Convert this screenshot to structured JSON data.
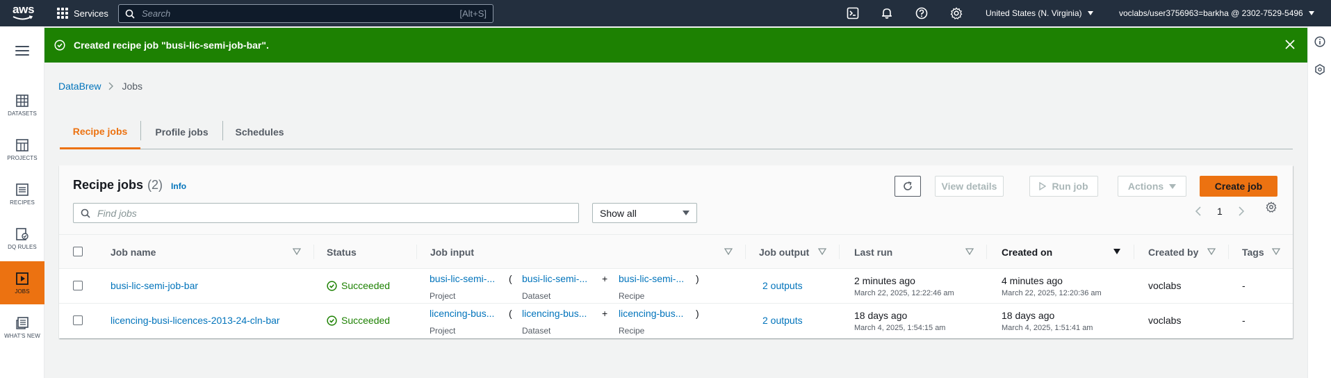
{
  "topnav": {
    "logo_text": "aws",
    "services_label": "Services",
    "search_placeholder": "Search",
    "search_shortcut": "[Alt+S]",
    "icons": [
      "cloudshell-icon",
      "bell-icon",
      "help-icon",
      "settings-icon"
    ],
    "region": "United States (N. Virginia)",
    "account": "voclabs/user3756963=barkha @ 2302-7529-5496"
  },
  "leftrail": {
    "items": [
      {
        "label": "DATASETS",
        "icon": "table-icon"
      },
      {
        "label": "PROJECTS",
        "icon": "grid-icon"
      },
      {
        "label": "RECIPES",
        "icon": "list-icon"
      },
      {
        "label": "DQ RULES",
        "icon": "rules-icon"
      },
      {
        "label": "JOBS",
        "icon": "play-icon"
      },
      {
        "label": "WHAT'S NEW",
        "icon": "news-icon"
      }
    ]
  },
  "flash": {
    "message": "Created recipe job \"busi-lic-semi-job-bar\"."
  },
  "breadcrumb": [
    "DataBrew",
    "Jobs"
  ],
  "tabs": [
    "Recipe jobs",
    "Profile jobs",
    "Schedules"
  ],
  "panel": {
    "title": "Recipe jobs",
    "count": "(2)",
    "info": "Info",
    "buttons": {
      "view_details": "View details",
      "run_job": "Run job",
      "actions": "Actions",
      "create_job": "Create job"
    },
    "find_placeholder": "Find jobs",
    "filter_value": "Show all",
    "page": "1"
  },
  "table": {
    "columns": [
      "Job name",
      "Status",
      "Job input",
      "Job output",
      "Last run",
      "Created on",
      "Created by",
      "Tags"
    ],
    "rows": [
      {
        "name": "busi-lic-semi-job-bar",
        "status": "Succeeded",
        "input_project": "busi-lic-semi-...",
        "input_project_label": "Project",
        "input_dataset": "busi-lic-semi-...",
        "input_dataset_label": "Dataset",
        "input_recipe": "busi-lic-semi-...",
        "input_recipe_label": "Recipe",
        "output": "2 outputs",
        "last_run_rel": "2 minutes ago",
        "last_run_abs": "March 22, 2025, 12:22:46 am",
        "created_rel": "4 minutes ago",
        "created_abs": "March 22, 2025, 12:20:36 am",
        "created_by": "voclabs",
        "tags": "-"
      },
      {
        "name": "licencing-busi-licences-2013-24-cln-bar",
        "status": "Succeeded",
        "input_project": "licencing-bus...",
        "input_project_label": "Project",
        "input_dataset": "licencing-bus...",
        "input_dataset_label": "Dataset",
        "input_recipe": "licencing-bus...",
        "input_recipe_label": "Recipe",
        "output": "2 outputs",
        "last_run_rel": "18 days ago",
        "last_run_abs": "March 4, 2025, 1:54:15 am",
        "created_rel": "18 days ago",
        "created_abs": "March 4, 2025, 1:51:41 am",
        "created_by": "voclabs",
        "tags": "-"
      }
    ]
  },
  "colors": {
    "accent": "#ec7211",
    "success": "#1d8102",
    "link": "#0073bb",
    "topnav": "#232f3e"
  }
}
